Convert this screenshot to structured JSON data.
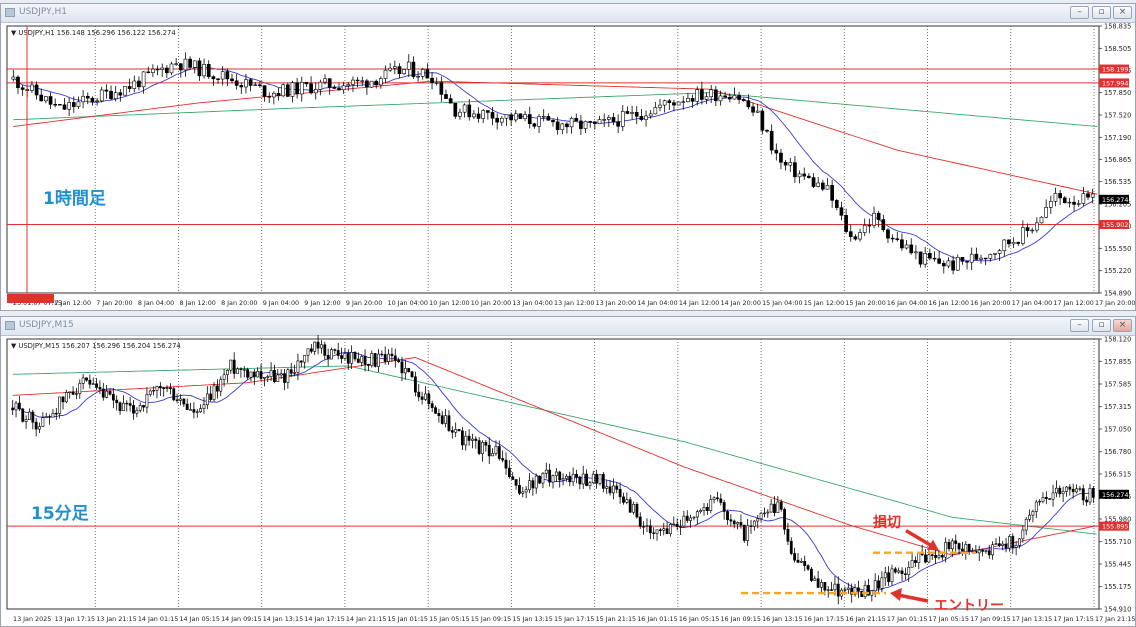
{
  "colors": {
    "bull": "#ffffff",
    "bear": "#000000",
    "ma_blue": "#3b3bd6",
    "ma_red": "#e0322a",
    "ma_green": "#3aa86a",
    "hline": "#e03030",
    "grid": "#555555",
    "text": "#222222",
    "accent": "#1f8fd1",
    "annotation": "#e0322a",
    "entry_line": "#f5a623"
  },
  "top": {
    "title": "USDJPY,H1",
    "info": "USDJPY,H1  156.148 156.296 156.122 156.274",
    "label": "1時間足",
    "price_labels": [
      "158.835",
      "158.505",
      "158.175",
      "157.850",
      "157.520",
      "157.190",
      "156.865",
      "156.535",
      "156.205",
      "155.880",
      "155.550",
      "155.220",
      "154.890"
    ],
    "price_range": [
      154.89,
      158.835
    ],
    "time_labels": [
      "25.01.07 07:15",
      "7 Jan 12:00",
      "7 Jan 20:00",
      "8 Jan 04:00",
      "8 Jan 12:00",
      "8 Jan 20:00",
      "9 Jan 04:00",
      "9 Jan 12:00",
      "9 Jan 20:00",
      "10 Jan 04:00",
      "10 Jan 12:00",
      "10 Jan 20:00",
      "13 Jan 04:00",
      "13 Jan 12:00",
      "13 Jan 20:00",
      "14 Jan 04:00",
      "14 Jan 12:00",
      "14 Jan 20:00",
      "15 Jan 04:00",
      "15 Jan 12:00",
      "15 Jan 20:00",
      "16 Jan 04:00",
      "16 Jan 12:00",
      "16 Jan 20:00",
      "17 Jan 04:00",
      "17 Jan 12:00",
      "17 Jan 20:00"
    ],
    "hlines": [
      {
        "label": "158.199",
        "value": 158.199
      },
      {
        "label": "157.994",
        "value": 157.994
      },
      {
        "label": "155.902",
        "value": 155.902
      }
    ],
    "current": {
      "label": "156.274",
      "value": 156.274
    },
    "chart_data": {
      "type": "candlestick",
      "timeframe": "H1",
      "anchors": [
        [
          0,
          158.05
        ],
        [
          10,
          157.6
        ],
        [
          25,
          157.95
        ],
        [
          35,
          158.3
        ],
        [
          45,
          158.1
        ],
        [
          55,
          157.85
        ],
        [
          65,
          157.95
        ],
        [
          75,
          158.0
        ],
        [
          85,
          158.2
        ],
        [
          90,
          158.1
        ],
        [
          95,
          157.6
        ],
        [
          105,
          157.5
        ],
        [
          115,
          157.4
        ],
        [
          125,
          157.35
        ],
        [
          135,
          157.55
        ],
        [
          145,
          157.8
        ],
        [
          155,
          157.85
        ],
        [
          160,
          157.5
        ],
        [
          165,
          156.8
        ],
        [
          175,
          156.4
        ],
        [
          180,
          155.7
        ],
        [
          185,
          156.0
        ],
        [
          190,
          155.65
        ],
        [
          195,
          155.4
        ],
        [
          202,
          155.3
        ],
        [
          210,
          155.5
        ],
        [
          218,
          155.8
        ],
        [
          224,
          156.3
        ],
        [
          232,
          156.25
        ]
      ]
    }
  },
  "bottom": {
    "title": "USDJPY,M15",
    "info": "USDJPY,M15  156.207 156.296 156.204 156.274",
    "label": "15分足",
    "price_labels": [
      "158.120",
      "157.855",
      "157.585",
      "157.315",
      "157.050",
      "156.780",
      "156.515",
      "156.245",
      "155.980",
      "155.710",
      "155.445",
      "155.175",
      "154.910"
    ],
    "price_range": [
      154.91,
      158.12
    ],
    "time_labels": [
      "13 Jan 2025",
      "13 Jan 17:15",
      "13 Jan 21:15",
      "14 Jan 01:15",
      "14 Jan 05:15",
      "14 Jan 09:15",
      "14 Jan 13:15",
      "14 Jan 17:15",
      "14 Jan 21:15",
      "15 Jan 01:15",
      "15 Jan 05:15",
      "15 Jan 09:15",
      "15 Jan 13:15",
      "15 Jan 17:15",
      "15 Jan 21:15",
      "16 Jan 01:15",
      "16 Jan 05:15",
      "16 Jan 09:15",
      "16 Jan 13:15",
      "16 Jan 17:15",
      "16 Jan 21:15",
      "17 Jan 01:15",
      "17 Jan 05:15",
      "17 Jan 09:15",
      "17 Jan 13:15",
      "17 Jan 17:15",
      "17 Jan 21:15"
    ],
    "hlines": [
      {
        "label": "155.895",
        "value": 155.895
      }
    ],
    "current": {
      "label": "156.274",
      "value": 156.274
    },
    "annotations": {
      "stop": "損切",
      "entry": "エントリー"
    },
    "stop_level": 155.58,
    "entry_level": 155.1,
    "chart_data": {
      "type": "candlestick",
      "timeframe": "M15",
      "anchors": [
        [
          0,
          157.3
        ],
        [
          8,
          157.1
        ],
        [
          20,
          157.6
        ],
        [
          35,
          157.25
        ],
        [
          45,
          157.55
        ],
        [
          55,
          157.2
        ],
        [
          65,
          157.8
        ],
        [
          80,
          157.65
        ],
        [
          90,
          158.0
        ],
        [
          100,
          157.9
        ],
        [
          115,
          157.85
        ],
        [
          125,
          157.3
        ],
        [
          135,
          156.9
        ],
        [
          145,
          156.75
        ],
        [
          150,
          156.3
        ],
        [
          160,
          156.5
        ],
        [
          175,
          156.45
        ],
        [
          185,
          156.1
        ],
        [
          190,
          155.75
        ],
        [
          200,
          156.0
        ],
        [
          210,
          156.2
        ],
        [
          218,
          155.8
        ],
        [
          228,
          156.15
        ],
        [
          233,
          155.5
        ],
        [
          240,
          155.2
        ],
        [
          252,
          155.1
        ],
        [
          262,
          155.3
        ],
        [
          272,
          155.55
        ],
        [
          280,
          155.65
        ],
        [
          290,
          155.6
        ],
        [
          300,
          155.75
        ],
        [
          305,
          156.2
        ],
        [
          312,
          156.35
        ],
        [
          322,
          156.25
        ]
      ]
    }
  }
}
